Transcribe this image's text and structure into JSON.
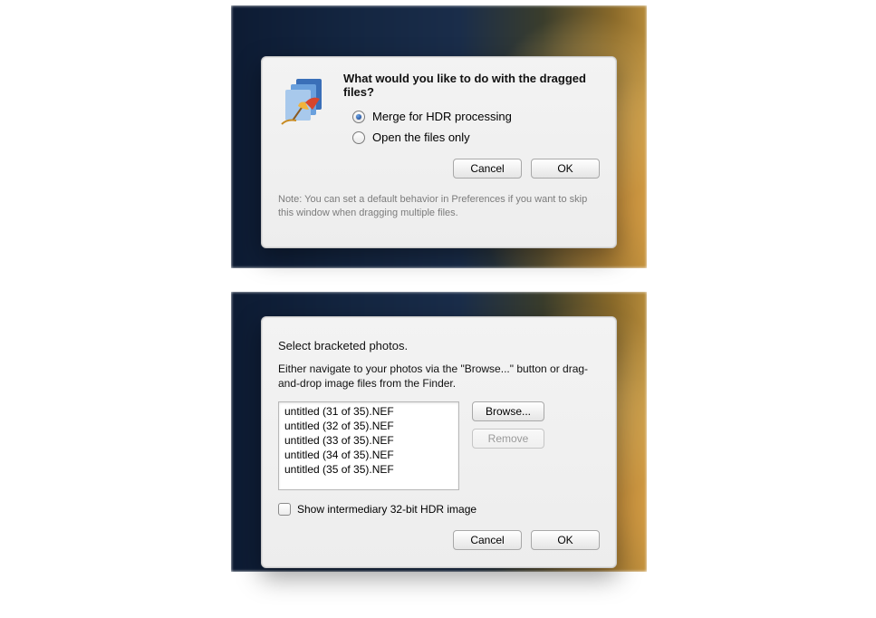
{
  "dialog1": {
    "title": "What would you like to do with the dragged files?",
    "options": {
      "merge": "Merge for HDR processing",
      "open": "Open the files only"
    },
    "buttons": {
      "cancel": "Cancel",
      "ok": "OK"
    },
    "note": "Note: You can set a default behavior in Preferences if you want to skip this window when dragging multiple files."
  },
  "dialog2": {
    "title": "Select bracketed photos.",
    "description": "Either navigate to your photos via the \"Browse...\" button or drag-and-drop image files from the Finder.",
    "files": [
      "untitled (31 of 35).NEF",
      "untitled (32 of 35).NEF",
      "untitled (33 of 35).NEF",
      "untitled (34 of 35).NEF",
      "untitled (35 of 35).NEF"
    ],
    "buttons": {
      "browse": "Browse...",
      "remove": "Remove",
      "cancel": "Cancel",
      "ok": "OK"
    },
    "checkbox_label": "Show intermediary 32-bit HDR image"
  }
}
